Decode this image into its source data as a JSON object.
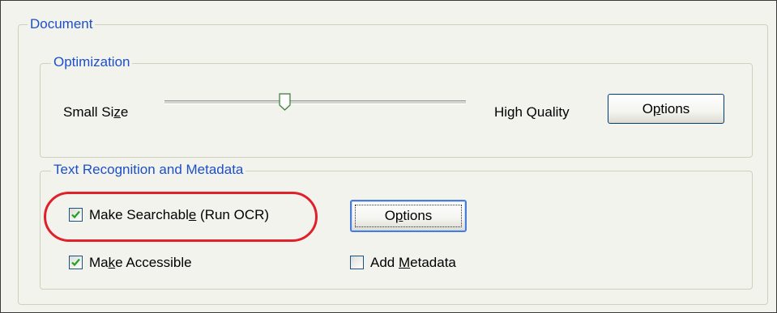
{
  "document_group": {
    "legend": "Document"
  },
  "optimization": {
    "legend": "Optimization",
    "min_label_pre": "Small Si",
    "min_label_u": "z",
    "min_label_post": "e",
    "max_label": "High Quality",
    "slider_fraction": 0.4,
    "options_pre": "O",
    "options_u": "p",
    "options_post": "tions"
  },
  "text_recognition": {
    "legend": "Text Recognition and Metadata",
    "searchable": {
      "pre": "Make Searchabl",
      "u": "e",
      "post": " (Run OCR)",
      "checked": true
    },
    "ocr_options_pre": "O",
    "ocr_options_u": "p",
    "ocr_options_post": "tions",
    "accessible": {
      "pre": "Ma",
      "u": "k",
      "post": "e Accessible",
      "checked": true
    },
    "metadata": {
      "pre": "Add ",
      "u": "M",
      "post": "etadata",
      "checked": false
    }
  },
  "colors": {
    "legend_text": "#1d4fc7",
    "highlight": "#e0202a",
    "check_mark": "#21a121"
  }
}
